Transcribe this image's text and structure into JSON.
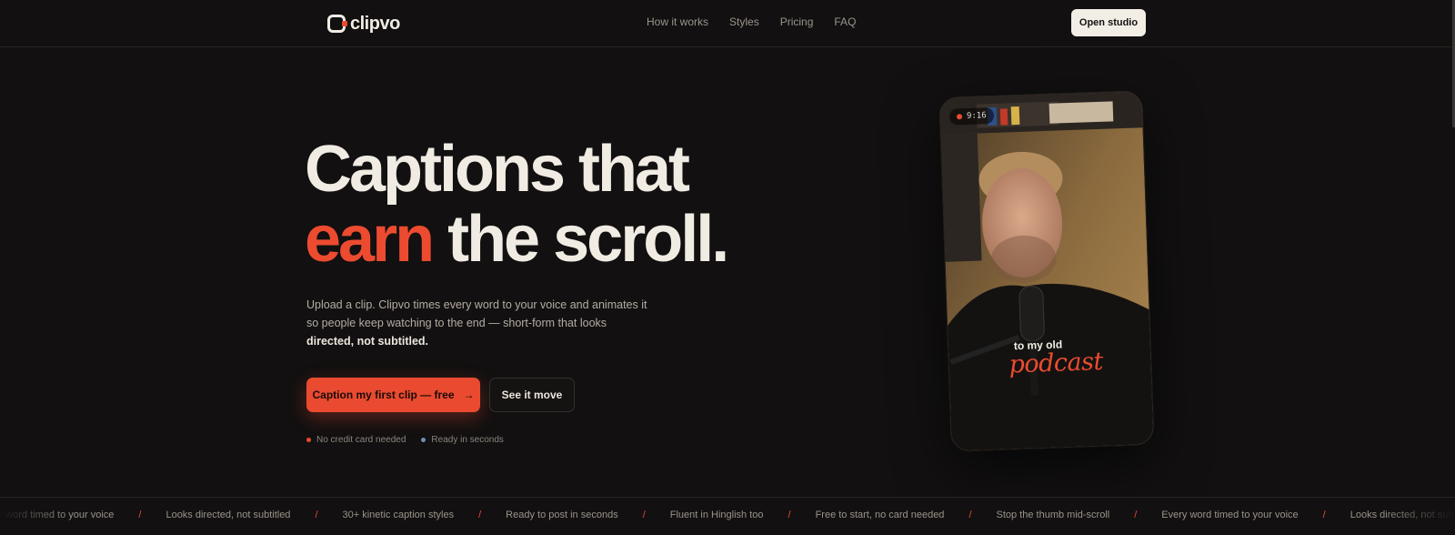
{
  "brand": {
    "name": "clipvo"
  },
  "nav": {
    "links": [
      "How it works",
      "Styles",
      "Pricing",
      "FAQ"
    ],
    "cta": "Open studio"
  },
  "hero": {
    "headline_line1": "Captions that",
    "headline_accent": "earn",
    "headline_rest": " the scroll.",
    "sub_text": "Upload a clip. Clipvo times every word to your voice and animates it so people keep watching to the end — short-form that looks",
    "sub_bold": "directed, not subtitled.",
    "primary_cta": "Caption my first clip — free",
    "primary_cta_arrow": "→",
    "secondary_cta": "See it move",
    "notes": [
      {
        "text": "No credit card needed",
        "dot_color": "#e94a30"
      },
      {
        "text": "Ready in seconds",
        "dot_color": "#6d8fb8"
      }
    ]
  },
  "preview": {
    "aspect_badge": "9:16",
    "caption_line": "to my old",
    "caption_highlight": "podcast"
  },
  "ticker": {
    "items": [
      "Every word timed to your voice",
      "Looks directed, not subtitled",
      "30+ kinetic caption styles",
      "Ready to post in seconds",
      "Fluent in Hinglish too",
      "Free to start, no card needed",
      "Stop the thumb mid-scroll",
      "Every word timed to your voice",
      "Looks directed, not subtitled"
    ],
    "separator": "/"
  },
  "colors": {
    "background": "#121010",
    "accent": "#e94a30",
    "text": "#efeae2"
  }
}
